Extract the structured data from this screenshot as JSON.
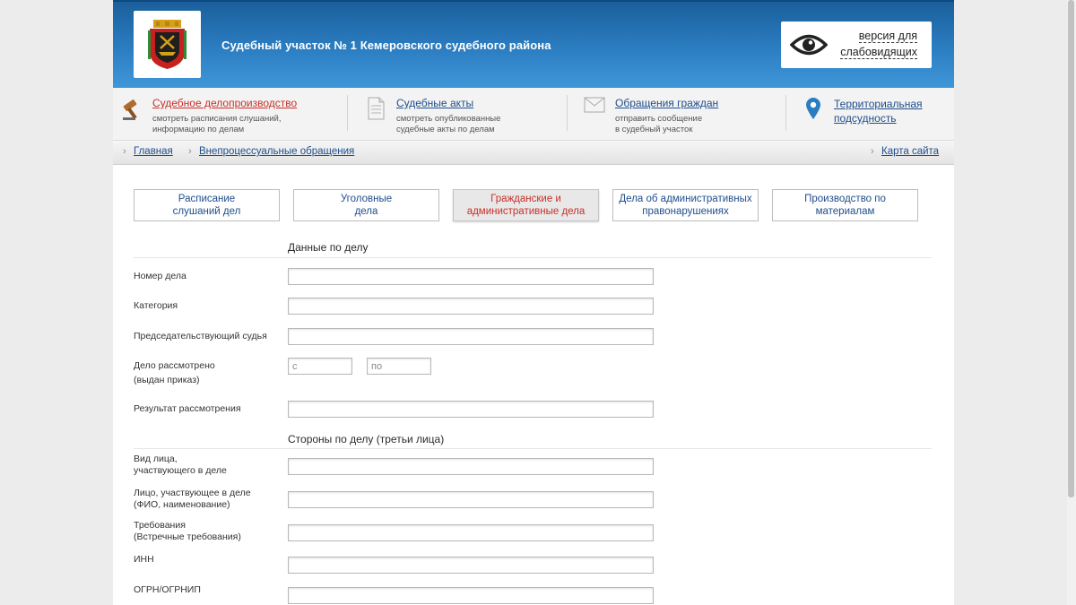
{
  "header": {
    "site_title": "Судебный участок № 1 Кемеровского судебного района",
    "vision_line1": "версия для",
    "vision_line2": "слабовидящих"
  },
  "nav": {
    "items": [
      {
        "title": "Судебное делопроизводство",
        "sub1": "смотреть расписания слушаний,",
        "sub2": "информацию по делам",
        "icon": "gavel-icon"
      },
      {
        "title": "Судебные акты",
        "sub1": "смотреть опубликованные",
        "sub2": "судебные акты по делам",
        "icon": "document-icon"
      },
      {
        "title": "Обращения граждан",
        "sub1": "отправить сообщение",
        "sub2": "в судебный участок",
        "icon": "envelope-icon"
      },
      {
        "title1": "Территориальная",
        "title2": "подсудность",
        "icon": "map-pin-icon"
      }
    ]
  },
  "breadcrumb": {
    "home": "Главная",
    "current": "Внепроцессуальные обращения",
    "sitemap": "Карта сайта"
  },
  "tabs": [
    {
      "line1": "Расписание",
      "line2": "слушаний дел"
    },
    {
      "line1": "Уголовные",
      "line2": "дела"
    },
    {
      "line1": "Гражданские и",
      "line2": "административные дела"
    },
    {
      "line1": "Дела об административных",
      "line2": "правонарушениях"
    },
    {
      "line1": "Производство по",
      "line2": "материалам"
    }
  ],
  "form": {
    "section1_title": "Данные по делу",
    "case_number_label": "Номер дела",
    "category_label": "Категория",
    "judge_label": "Председательствующий судья",
    "reviewed_label1": "Дело рассмотрено",
    "reviewed_label2": "(выдан приказ)",
    "date_from_placeholder": "с",
    "date_to_placeholder": "по",
    "result_label": "Результат рассмотрения",
    "section2_title": "Стороны по делу (третьи лица)",
    "party_type_label1": "Вид лица,",
    "party_type_label2": "участвующего в деле",
    "party_name_label1": "Лицо, участвующее в деле",
    "party_name_label2": "(ФИО, наименование)",
    "claims_label1": "Требования",
    "claims_label2": "(Встречные требования)",
    "inn_label": "ИНН",
    "ogrn_label": "ОГРН/ОГРНИП"
  },
  "colors": {
    "header_blue": "#2b7dc1",
    "link_blue": "#1f4e8c",
    "accent_red": "#c8302a"
  }
}
